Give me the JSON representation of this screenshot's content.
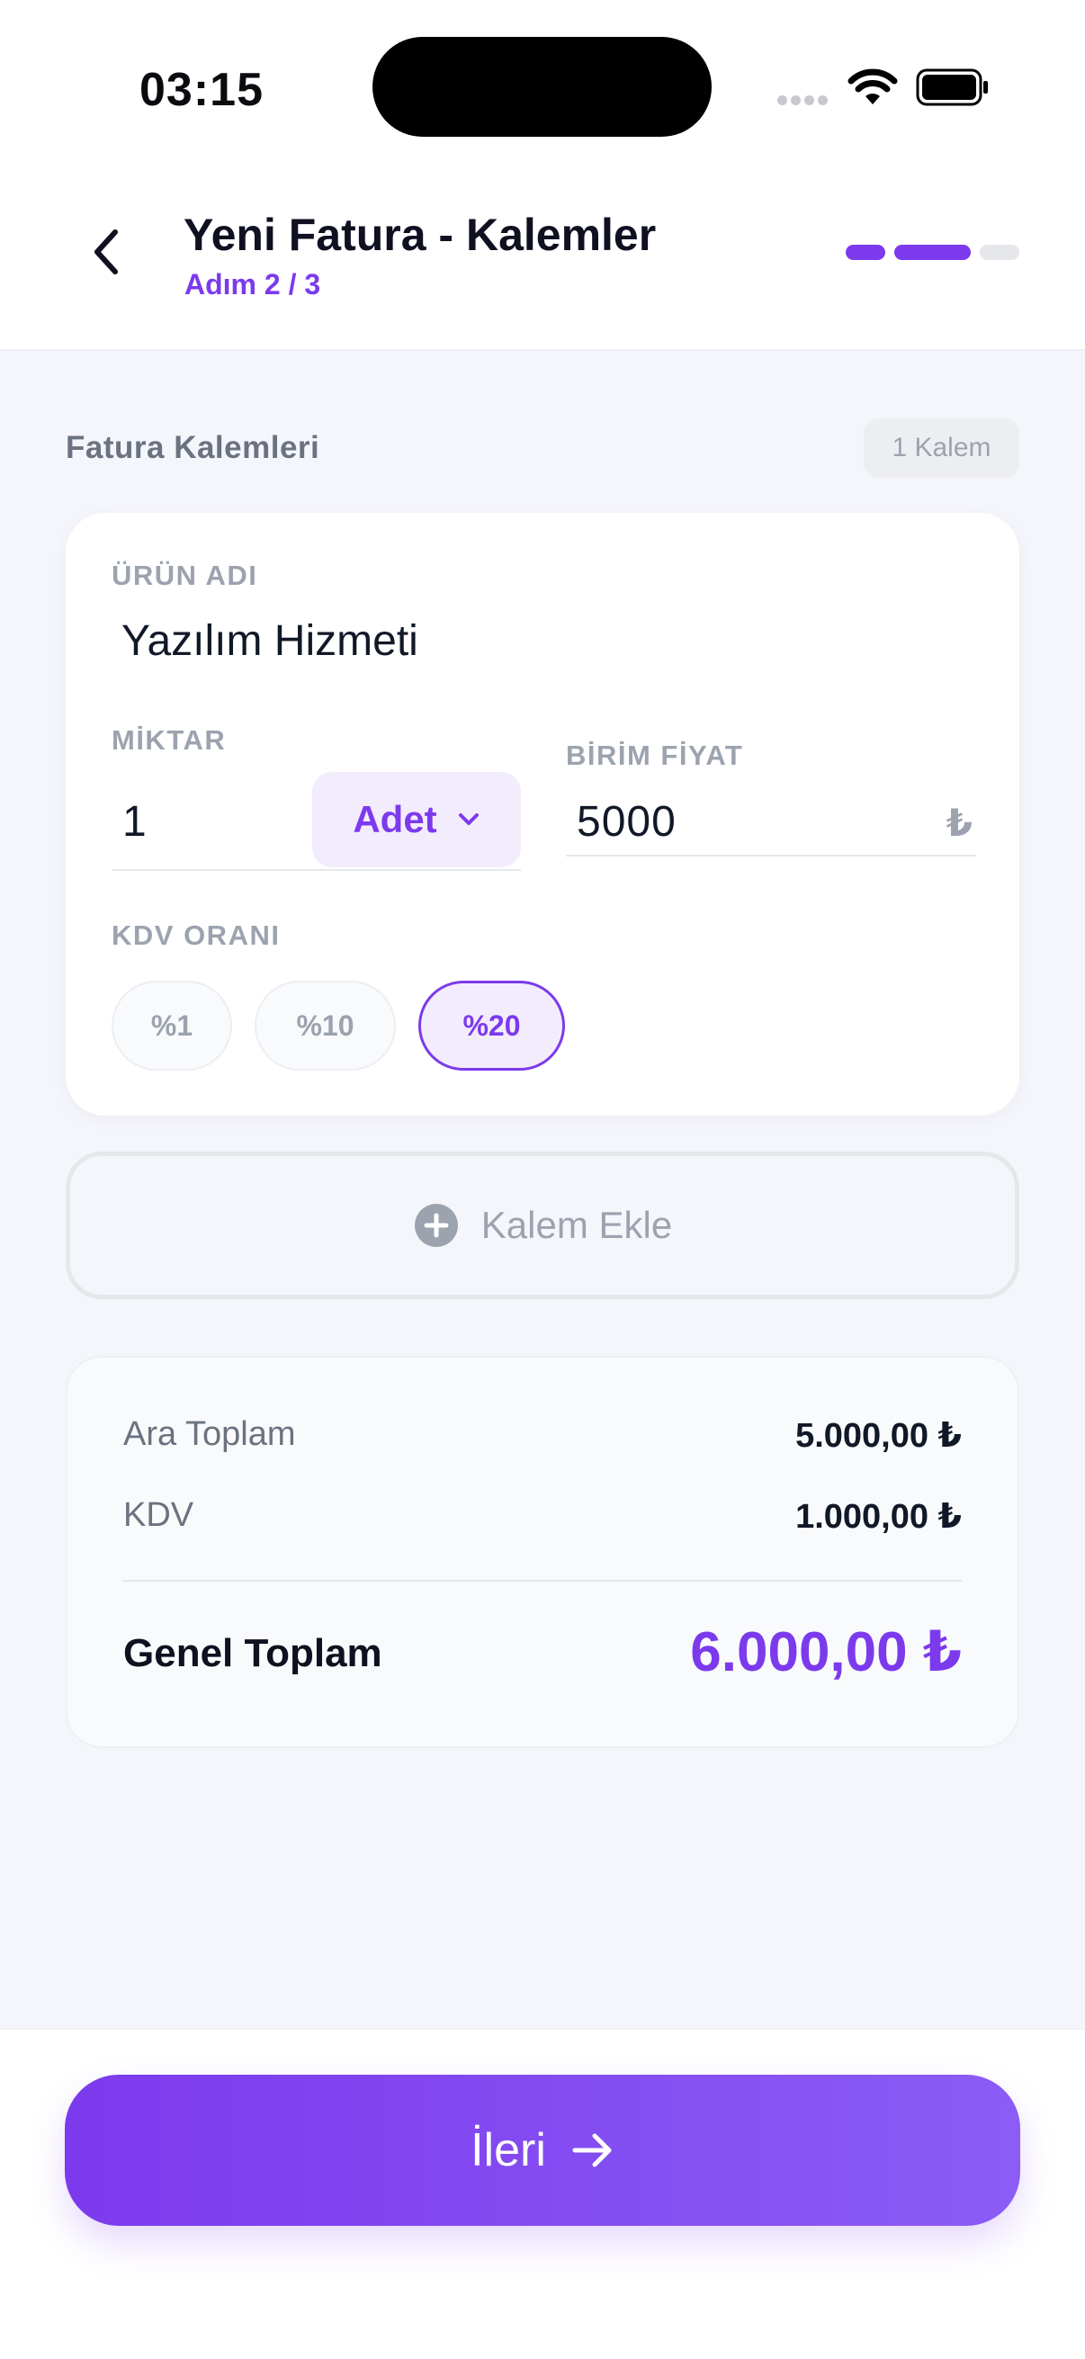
{
  "status_bar": {
    "time": "03:15"
  },
  "header": {
    "title": "Yeni Fatura - Kalemler",
    "step": "Adım 2 / 3",
    "steps_total": 3,
    "step_current": 2
  },
  "section": {
    "title": "Fatura Kalemleri",
    "count": "1 Kalem"
  },
  "item": {
    "product_label": "ÜRÜN ADI",
    "product_value": "Yazılım Hizmeti",
    "quantity_label": "MİKTAR",
    "quantity_value": "1",
    "unit_value": "Adet",
    "unit_price_label": "BİRİM FİYAT",
    "unit_price_value": "5000",
    "currency_symbol": "₺",
    "vat_label": "KDV ORANI",
    "vat_options": [
      "%1",
      "%10",
      "%20"
    ],
    "vat_selected": "%20"
  },
  "add_item": {
    "label": "Kalem Ekle"
  },
  "totals": {
    "subtotal_label": "Ara Toplam",
    "subtotal_value": "5.000,00 ₺",
    "vat_label": "KDV",
    "vat_value": "1.000,00 ₺",
    "grand_label": "Genel Toplam",
    "grand_value": "6.000,00 ₺"
  },
  "footer": {
    "next_label": "İleri"
  },
  "colors": {
    "accent": "#7c3aed",
    "muted": "#9ca3af",
    "background": "#f5f6fb"
  },
  "icons": [
    "wifi-icon",
    "battery-icon",
    "chevron-left-icon",
    "chevron-down-icon",
    "plus-circle-icon",
    "arrow-right-icon"
  ]
}
